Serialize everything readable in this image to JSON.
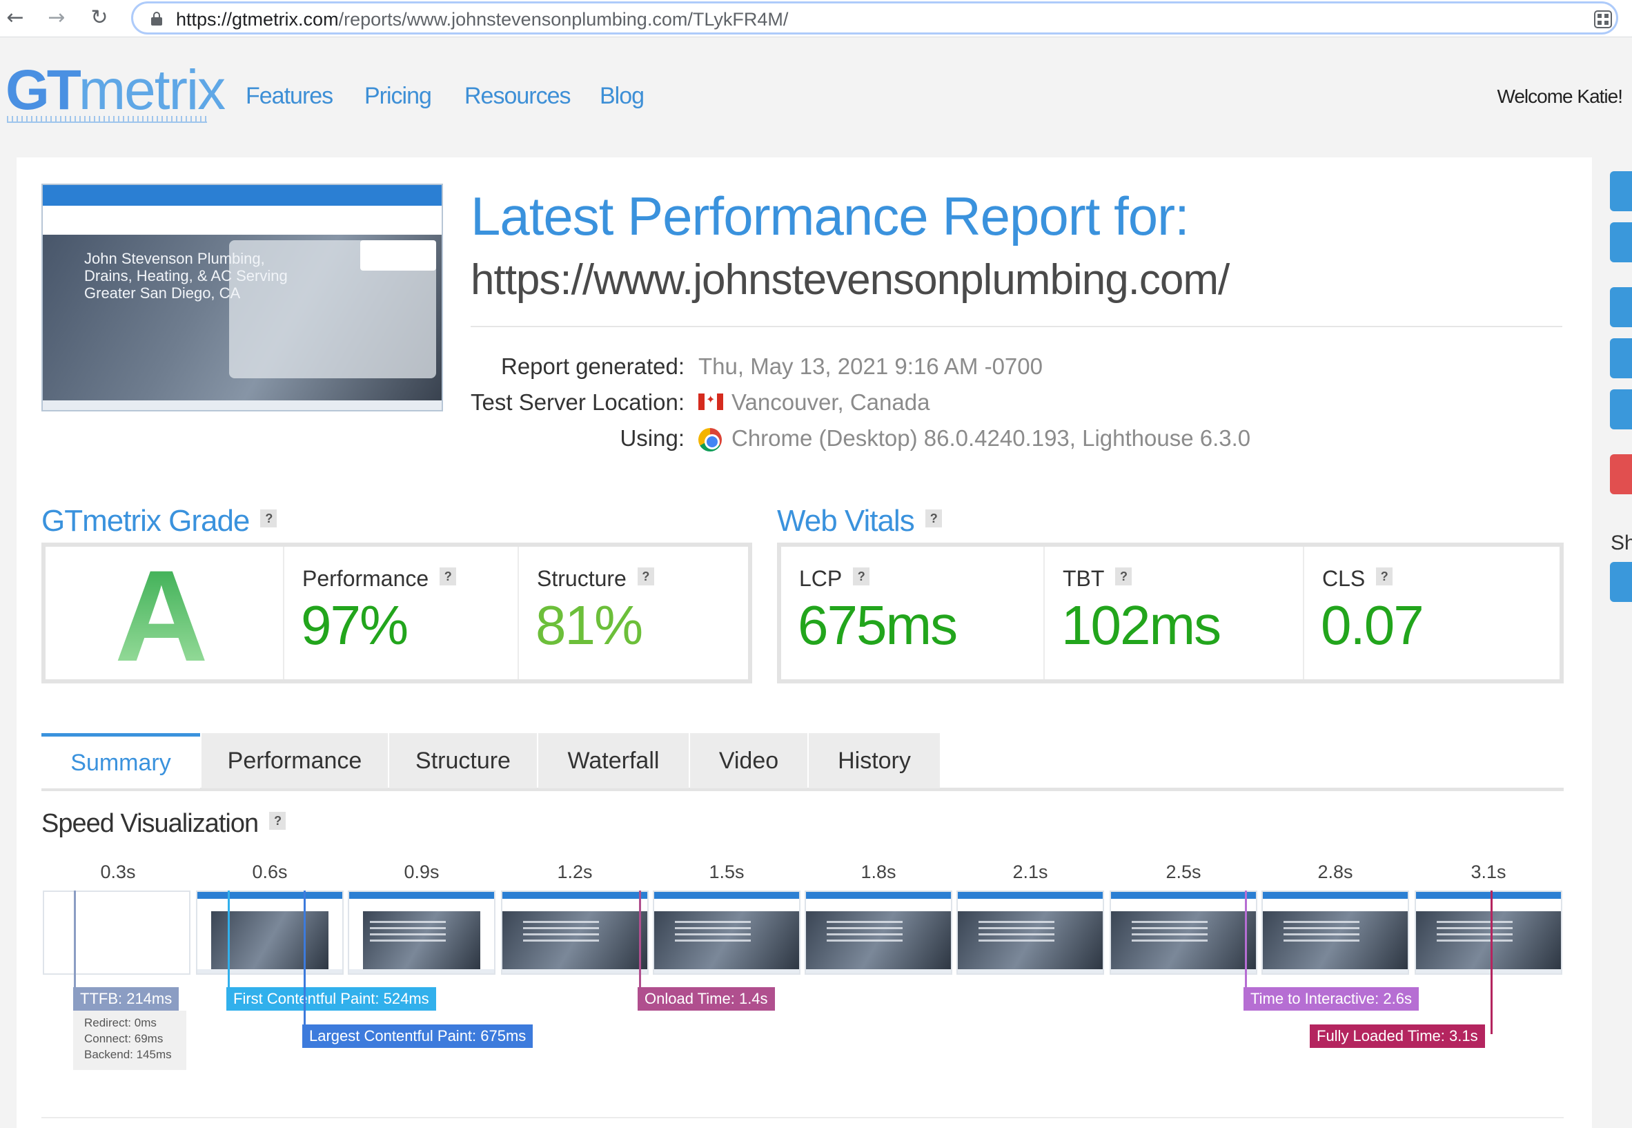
{
  "browser": {
    "url_host": "https://gtmetrix.com",
    "url_path": "/reports/www.johnstevensonplumbing.com/TLykFR4M/"
  },
  "header": {
    "logo_gt": "GT",
    "logo_metrix": "metrix",
    "nav": [
      "Features",
      "Pricing",
      "Resources",
      "Blog"
    ],
    "welcome": "Welcome Katie!"
  },
  "thumbnail": {
    "headline": "John Stevenson Plumbing, Drains, Heating, & AC Serving Greater San Diego, CA"
  },
  "report": {
    "title": "Latest Performance Report for:",
    "url": "https://www.johnstevensonplumbing.com/",
    "meta": [
      {
        "label": "Report generated:",
        "value": "Thu, May 13, 2021 9:16 AM -0700",
        "icon": ""
      },
      {
        "label": "Test Server Location:",
        "value": "Vancouver, Canada",
        "icon": "canada-flag-icon"
      },
      {
        "label": "Using:",
        "value": "Chrome (Desktop) 86.0.4240.193, Lighthouse 6.3.0",
        "icon": "chrome-icon"
      }
    ]
  },
  "grade": {
    "title": "GTmetrix Grade",
    "letter": "A",
    "performance_label": "Performance",
    "performance_value": "97%",
    "structure_label": "Structure",
    "structure_value": "81%",
    "performance_color": "#22a51c",
    "structure_color": "#6cbf3a"
  },
  "vitals": {
    "title": "Web Vitals",
    "items": [
      {
        "label": "LCP",
        "value": "675ms"
      },
      {
        "label": "TBT",
        "value": "102ms"
      },
      {
        "label": "CLS",
        "value": "0.07"
      }
    ]
  },
  "tabs": [
    "Summary",
    "Performance",
    "Structure",
    "Waterfall",
    "Video",
    "History"
  ],
  "speed": {
    "title": "Speed Visualization",
    "ticks": [
      "0.3s",
      "0.6s",
      "0.9s",
      "1.2s",
      "1.5s",
      "1.8s",
      "2.1s",
      "2.5s",
      "2.8s",
      "3.1s"
    ],
    "markers": [
      {
        "label": "TTFB: 214ms",
        "color": "#8b9dc3"
      },
      {
        "label": "First Contentful Paint: 524ms",
        "color": "#31b0ec"
      },
      {
        "label": "Largest Contentful Paint: 675ms",
        "color": "#3d7bdc"
      },
      {
        "label": "Onload Time: 1.4s",
        "color": "#b04f8e"
      },
      {
        "label": "Time to Interactive: 2.6s",
        "color": "#b66ed3"
      },
      {
        "label": "Fully Loaded Time: 3.1s",
        "color": "#b4255f"
      }
    ],
    "ttfb_details": [
      "Redirect: 0ms",
      "Connect: 69ms",
      "Backend: 145ms"
    ]
  },
  "sidebar": {
    "share_label": "Sh"
  },
  "help_mark": "?"
}
